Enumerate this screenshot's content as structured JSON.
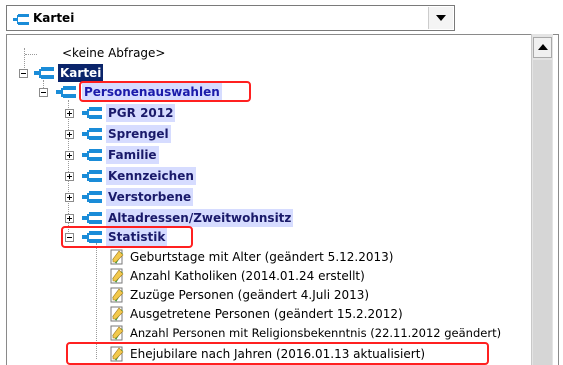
{
  "combo": {
    "selected": "Kartei"
  },
  "tree": {
    "no_query": "<keine Abfrage>",
    "root": "Kartei",
    "group": "Personenauswahlen",
    "items": [
      "PGR 2012",
      "Sprengel",
      "Familie",
      "Kennzeichen",
      "Verstorbene",
      "Altadressen/Zweitwohnsitz",
      "Statistik"
    ],
    "statistik_children": [
      "Geburtstage mit Alter (geändert 5.12.2013)",
      "Anzahl Katholiken (2014.01.24 erstellt)",
      "Zuzüge Personen (geändert 4.Juli 2013)",
      "Ausgetretene Personen (geändert 15.2.2012)",
      "Anzahl Personen mit Religionsbekenntnis (22.11.2012 geändert)",
      "Ehejubilare nach Jahren (2016.01.13 aktualisiert)"
    ]
  },
  "colors": {
    "highlight": "#d6dcff",
    "selected": "#0a246a",
    "annotation": "#ff2020"
  }
}
